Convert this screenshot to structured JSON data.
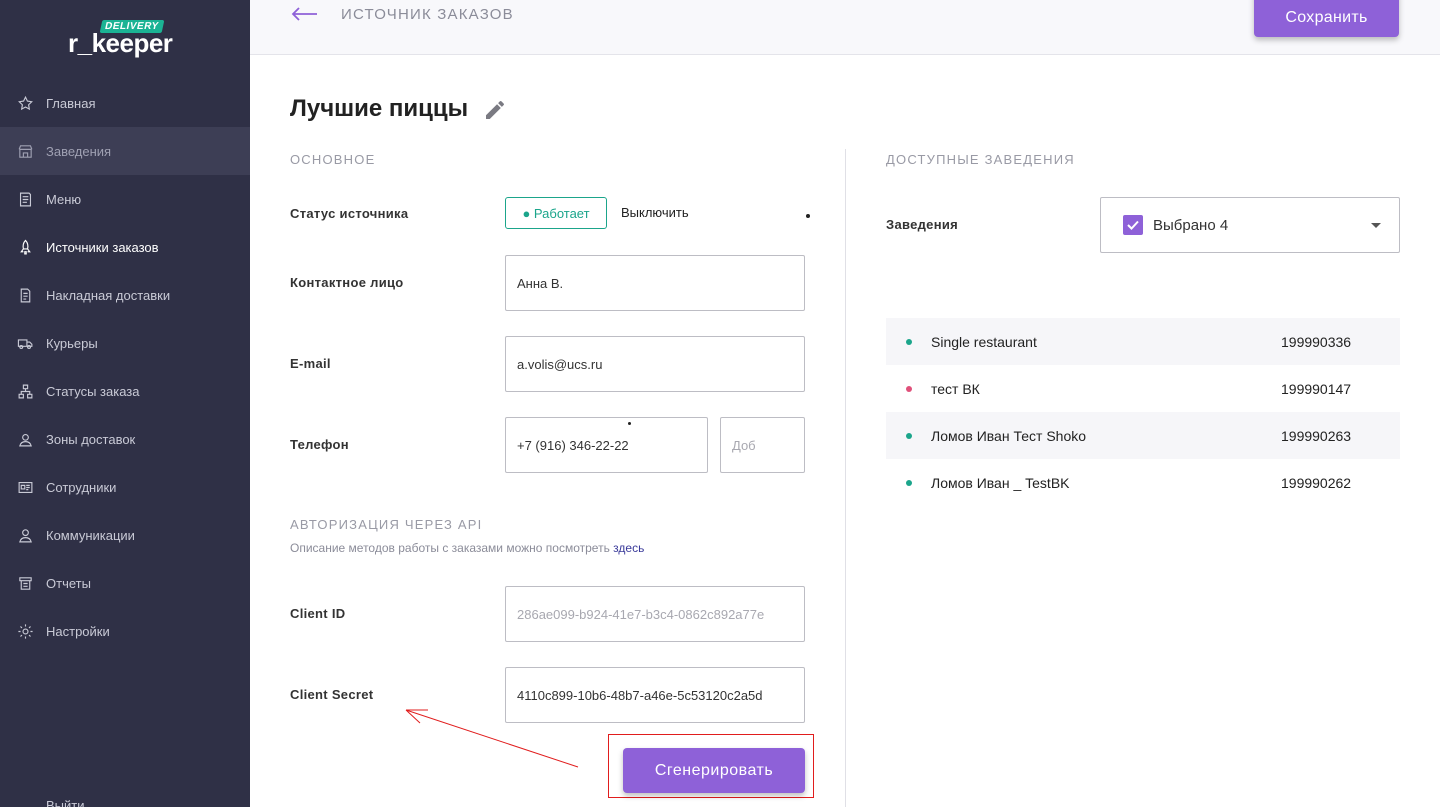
{
  "brand": {
    "badge": "DELIVERY",
    "word": "r_keeper"
  },
  "sidebar": {
    "items": [
      {
        "label": "Главная",
        "icon": "star-icon"
      },
      {
        "label": "Заведения",
        "icon": "store-icon"
      },
      {
        "label": "Меню",
        "icon": "menu-book-icon"
      },
      {
        "label": "Источники заказов",
        "icon": "rocket-icon"
      },
      {
        "label": "Накладная доставки",
        "icon": "document-icon"
      },
      {
        "label": "Курьеры",
        "icon": "truck-icon"
      },
      {
        "label": "Статусы заказа",
        "icon": "hierarchy-icon"
      },
      {
        "label": "Зоны доставок",
        "icon": "map-pin-icon"
      },
      {
        "label": "Сотрудники",
        "icon": "id-card-icon"
      },
      {
        "label": "Коммуникации",
        "icon": "person-icon"
      },
      {
        "label": "Отчеты",
        "icon": "report-icon"
      },
      {
        "label": "Настройки",
        "icon": "gear-icon"
      }
    ],
    "logout": "Выйти"
  },
  "header": {
    "title": "ИСТОЧНИК ЗАКАЗОВ",
    "save": "Сохранить"
  },
  "main": {
    "title": "Лучшие пиццы",
    "section_basic": "ОСНОВНОЕ",
    "status_label": "Статус источника",
    "status_on": "● Работает",
    "status_off": "Выключить",
    "contact_label": "Контактное лицо",
    "contact_value": "Анна В.",
    "email_label": "E-mail",
    "email_value": "a.volis@ucs.ru",
    "phone_label": "Телефон",
    "phone_value": "+7 (916) 346-22-22",
    "phone_ext_placeholder": "Доб",
    "section_api": "АВТОРИЗАЦИЯ ЧЕРЕЗ API",
    "api_hint": "Описание методов работы с заказами можно посмотреть",
    "api_hint_link": "здесь",
    "client_id_label": "Client ID",
    "client_id_value": "286ae099-b924-41e7-b3c4-0862c892a77e",
    "client_secret_label": "Client Secret",
    "client_secret_value": "4110c899-10b6-48b7-a46e-5c53120c2a5d",
    "generate": "Сгенерировать"
  },
  "venues": {
    "section": "ДОСТУПНЫЕ ЗАВЕДЕНИЯ",
    "label": "Заведения",
    "selected": "Выбрано 4",
    "rows": [
      {
        "name": "Single restaurant",
        "id": "199990336",
        "status_color": "#1ba58b"
      },
      {
        "name": "тест ВК",
        "id": "199990147",
        "status_color": "#e0507a"
      },
      {
        "name": "Ломов Иван Тест Shoko",
        "id": "199990263",
        "status_color": "#1ba58b"
      },
      {
        "name": "Ломов Иван _ TestBK",
        "id": "199990262",
        "status_color": "#1ba58b"
      }
    ]
  },
  "colors": {
    "accent": "#8e61d8",
    "sidebar_bg": "#2f3046",
    "success": "#1ba58b",
    "annotation": "#e11d1d"
  }
}
